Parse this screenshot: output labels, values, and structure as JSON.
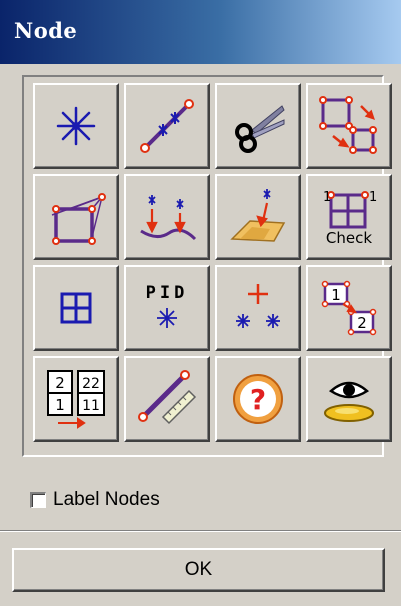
{
  "window": {
    "title": "Node"
  },
  "tools": [
    {
      "icon": "asterisk-node-icon"
    },
    {
      "icon": "nodes-on-line-icon"
    },
    {
      "icon": "scissors-icon"
    },
    {
      "icon": "copy-nodes-icon"
    },
    {
      "icon": "projected-square-icon"
    },
    {
      "icon": "project-to-curve-icon"
    },
    {
      "icon": "project-to-surface-icon"
    },
    {
      "icon": "check-grid-icon",
      "text": "Check",
      "corner": "1"
    },
    {
      "icon": "four-panel-grid-icon"
    },
    {
      "icon": "pid-node-icon",
      "text": "PID"
    },
    {
      "icon": "node-cluster-icon"
    },
    {
      "icon": "renumber-nodes-icon",
      "from": "1",
      "to": "2"
    },
    {
      "icon": "number-offset-icon",
      "cells": [
        "2",
        "22",
        "1",
        "11"
      ]
    },
    {
      "icon": "measure-ruler-icon"
    },
    {
      "icon": "help-question-icon",
      "text": "?"
    },
    {
      "icon": "eye-view-icon"
    }
  ],
  "options": {
    "label_nodes": "Label Nodes",
    "label_nodes_checked": false
  },
  "buttons": {
    "ok": "OK"
  },
  "colors": {
    "title_bar_start": "#0a246a",
    "title_bar_end": "#a6caf0",
    "face": "#d4d0c8",
    "icon_blue": "#1a1ab0",
    "icon_red": "#e03010",
    "icon_purple": "#5a2a8a"
  }
}
